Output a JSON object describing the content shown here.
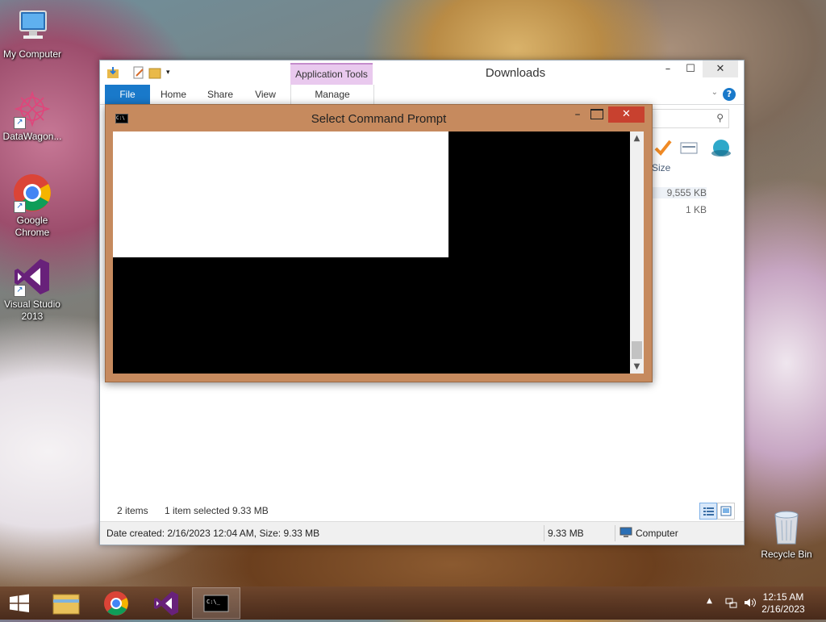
{
  "desktop": {
    "icons": [
      {
        "label": "My Computer"
      },
      {
        "label": "DataWagon..."
      },
      {
        "label": "Google Chrome"
      },
      {
        "label": "Visual Studio 2013"
      }
    ],
    "recycle_bin": "Recycle Bin"
  },
  "explorer": {
    "title": "Downloads",
    "context_tab": "Application Tools",
    "tabs": [
      "File",
      "Home",
      "Share",
      "View",
      "Manage"
    ],
    "column_size": "Size",
    "sizes": [
      "9,555 KB",
      "1 KB"
    ],
    "status": {
      "items": "2 items",
      "selected": "1 item selected  9.33 MB",
      "details": "Date created: 2/16/2023 12:04 AM, Size: 9.33 MB",
      "size": "9.33 MB",
      "location": "Computer"
    },
    "buttons": {
      "minimize": "–",
      "maximize": "☐",
      "close": "✕",
      "help": "?"
    }
  },
  "cmd": {
    "title": "Select Command Prompt",
    "icon_text": "C:\\",
    "close": "✕",
    "minimize": "–"
  },
  "taskbar": {
    "time": "12:15 AM",
    "date": "2/16/2023"
  }
}
